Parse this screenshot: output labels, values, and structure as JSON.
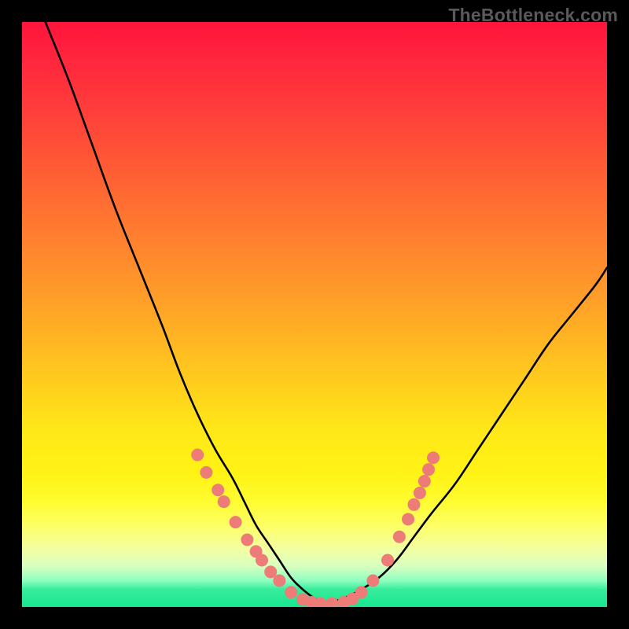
{
  "watermark": "TheBottleneck.com",
  "chart_data": {
    "type": "line",
    "title": "",
    "xlabel": "",
    "ylabel": "",
    "xlim": [
      0,
      100
    ],
    "ylim": [
      0,
      100
    ],
    "series": [
      {
        "name": "curve-left",
        "x": [
          4,
          8,
          12,
          16,
          20,
          24,
          27,
          30,
          33,
          36,
          38,
          40,
          42,
          44,
          46,
          48,
          50,
          52
        ],
        "y": [
          100,
          90,
          79,
          68,
          58,
          48,
          40,
          33,
          27,
          22,
          18,
          14,
          11,
          8,
          5,
          3,
          1.5,
          0.6
        ]
      },
      {
        "name": "curve-right",
        "x": [
          52,
          55,
          58,
          61,
          64,
          67,
          70,
          74,
          78,
          82,
          86,
          90,
          94,
          98,
          100
        ],
        "y": [
          0.6,
          1.5,
          3,
          5,
          8,
          12,
          16,
          21,
          27,
          33,
          39,
          45,
          50,
          55,
          58
        ]
      }
    ],
    "markers": [
      {
        "x": 30.0,
        "y": 26.0
      },
      {
        "x": 31.5,
        "y": 23.0
      },
      {
        "x": 33.5,
        "y": 20.0
      },
      {
        "x": 34.5,
        "y": 18.0
      },
      {
        "x": 36.5,
        "y": 14.5
      },
      {
        "x": 38.5,
        "y": 11.5
      },
      {
        "x": 40.0,
        "y": 9.5
      },
      {
        "x": 41.0,
        "y": 8.0
      },
      {
        "x": 42.5,
        "y": 6.0
      },
      {
        "x": 44.0,
        "y": 4.5
      },
      {
        "x": 46.0,
        "y": 2.5
      },
      {
        "x": 48.0,
        "y": 1.3
      },
      {
        "x": 49.5,
        "y": 0.8
      },
      {
        "x": 51.0,
        "y": 0.6
      },
      {
        "x": 53.0,
        "y": 0.6
      },
      {
        "x": 55.0,
        "y": 0.8
      },
      {
        "x": 56.5,
        "y": 1.4
      },
      {
        "x": 58.0,
        "y": 2.5
      },
      {
        "x": 60.0,
        "y": 4.5
      },
      {
        "x": 62.5,
        "y": 8.0
      },
      {
        "x": 64.5,
        "y": 12.0
      },
      {
        "x": 66.0,
        "y": 15.0
      },
      {
        "x": 67.0,
        "y": 17.5
      },
      {
        "x": 68.0,
        "y": 19.5
      },
      {
        "x": 68.8,
        "y": 21.5
      },
      {
        "x": 69.5,
        "y": 23.5
      },
      {
        "x": 70.3,
        "y": 25.5
      }
    ],
    "marker_color": "#ed7b78",
    "curve_color": "#000000"
  }
}
